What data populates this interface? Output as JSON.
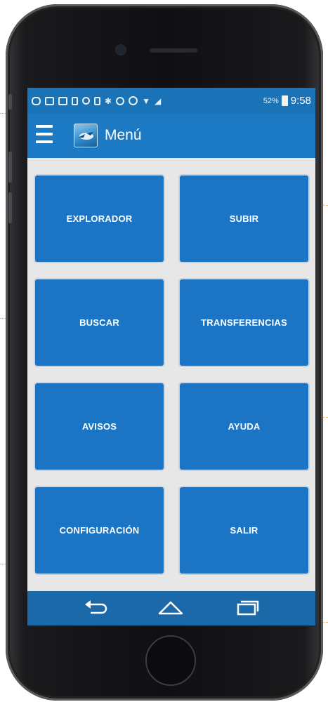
{
  "statusbar": {
    "battery_percent": "52%",
    "clock": "9:58"
  },
  "appbar": {
    "title": "Menú"
  },
  "menu": {
    "items": [
      {
        "label": "EXPLORADOR"
      },
      {
        "label": "SUBIR"
      },
      {
        "label": "BUSCAR"
      },
      {
        "label": "TRANSFERENCIAS"
      },
      {
        "label": "AVISOS"
      },
      {
        "label": "AYUDA"
      },
      {
        "label": "CONFIGURACIÓN"
      },
      {
        "label": "SALIR"
      }
    ]
  },
  "navbar": {
    "icons": [
      "back-icon",
      "home-icon",
      "recents-icon"
    ]
  },
  "colors": {
    "statusbar": "#1b73b7",
    "appbar": "#1c79c4",
    "tile": "#1b75c4",
    "navbar": "#1b69a9",
    "background": "#e7e7e7"
  }
}
